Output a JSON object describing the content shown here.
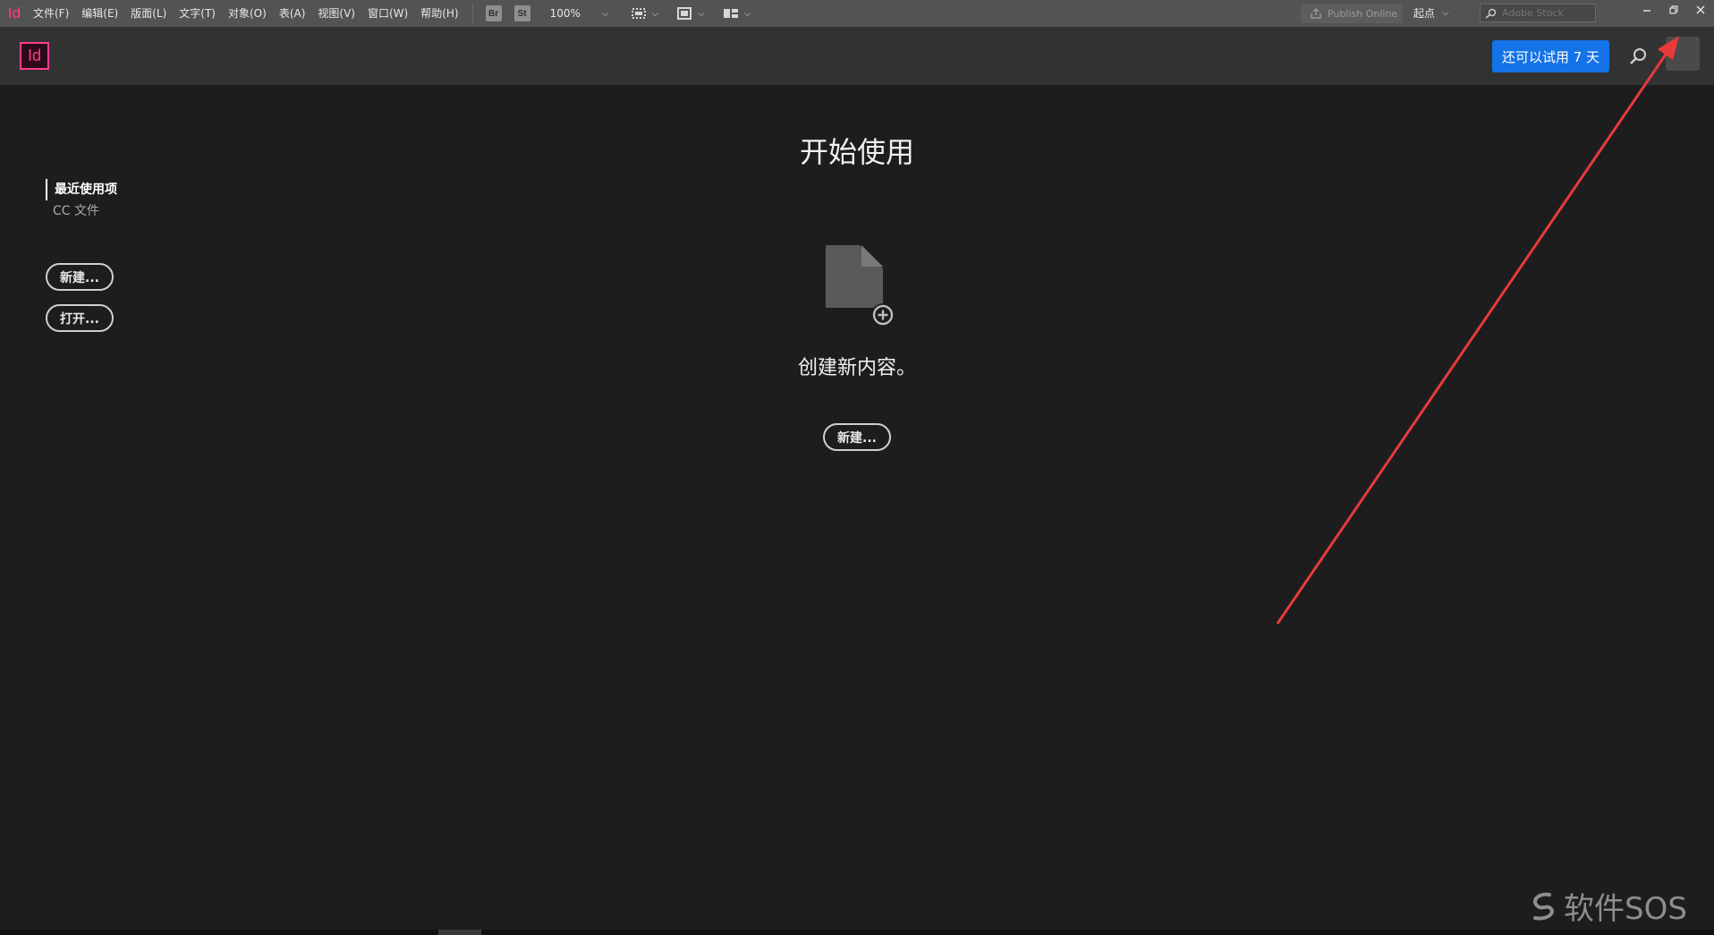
{
  "menubar": {
    "logo": "Id",
    "items": [
      "文件(F)",
      "编辑(E)",
      "版面(L)",
      "文字(T)",
      "对象(O)",
      "表(A)",
      "视图(V)",
      "窗口(W)",
      "帮助(H)"
    ],
    "badges": [
      "Br",
      "St"
    ],
    "zoom": "100%",
    "publish_label": "Publish Online",
    "workspace_label": "起点",
    "stock_placeholder": "Adobe Stock"
  },
  "header": {
    "logo": "Id",
    "trial_button": "还可以试用 7 天"
  },
  "sidebar": {
    "recent": "最近使用项",
    "cc_files": "CC 文件",
    "new_button": "新建...",
    "open_button": "打开..."
  },
  "main": {
    "title": "开始使用",
    "create_text": "创建新内容。",
    "new_button": "新建..."
  },
  "watermark": "软件SOS",
  "colors": {
    "accent": "#1473e6",
    "brand": "#ff3b8d",
    "annotation": "#e83a3a",
    "background": "#1d1d1d"
  }
}
